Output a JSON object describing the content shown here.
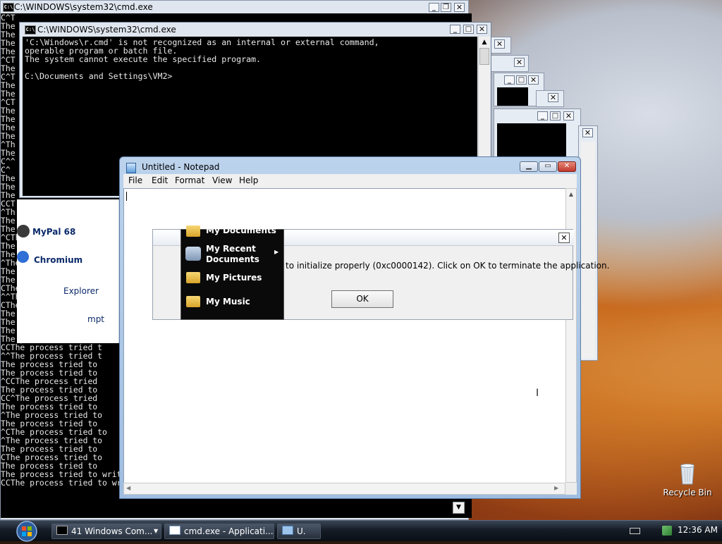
{
  "desktop": {
    "recycle_bin": "Recycle Bin"
  },
  "left_console": {
    "title": "C:\\WINDOWS\\system32\\cmd.exe",
    "lines": [
      "C^T",
      "The",
      "The",
      "The",
      "The",
      "^CT",
      "The",
      "C^T",
      "The",
      "The",
      "^CT",
      "The",
      "The",
      "The",
      "The",
      "^Th",
      "The",
      "C^^",
      "C^",
      "The",
      "The",
      "The",
      "CCT",
      "^Th",
      "The",
      "The",
      "^CThe",
      "The process",
      "The proce",
      "^The process",
      "The process",
      "The process",
      "CThe process tri",
      "^^The process tried",
      "CThe process tried",
      "The process tried t",
      "The process tried to",
      "The process tried to",
      "The process tried to",
      "CCThe process tried t",
      "^^The process tried t",
      "The process tried to",
      "The process tried to",
      "^CCThe process tried",
      "The process tried to",
      "CC^The process tried",
      "The process tried to",
      "^The process tried to",
      "The process tried to",
      "^CThe process tried to",
      "^The process tried to",
      "The process tried to",
      "CThe process tried to",
      "The process tried to",
      "The process tried to write to a nonexistent pipe. .",
      "CCThe process tried to write to a nonexistent pipe."
    ]
  },
  "front_cmd": {
    "title": "C:\\WINDOWS\\system32\\cmd.exe",
    "lines": [
      "'C:\\Windows\\r.cmd' is not recognized as an internal or external command,",
      "operable program or batch file.",
      "The system cannot execute the specified program.",
      "",
      "C:\\Documents and Settings\\VM2>"
    ]
  },
  "start_menu": {
    "items": [
      "MyPal 68",
      "Chromium",
      "Explorer",
      "mpt"
    ]
  },
  "notepad": {
    "title": "Untitled - Notepad",
    "menu": [
      "File",
      "Edit",
      "Format",
      "View",
      "Help"
    ]
  },
  "error_dialog": {
    "message": "to initialize properly (0xc0000142). Click on OK to terminate the application.",
    "ok": "OK"
  },
  "popup_menu": {
    "items": [
      "My Documents",
      "My Recent Documents",
      "My Pictures",
      "My Music"
    ]
  },
  "taskbar": {
    "buttons": [
      "41 Windows Com...",
      "cmd.exe - Applicati...",
      "U."
    ],
    "clock": "12:36 AM"
  }
}
